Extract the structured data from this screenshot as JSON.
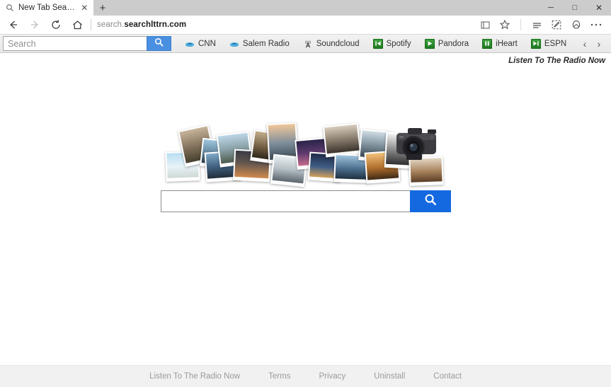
{
  "browser": {
    "tab": {
      "title": "New Tab Search",
      "favicon": "search-icon",
      "close_label": "✕"
    },
    "new_tab_label": "+",
    "window_controls": {
      "minimize": "─",
      "maximize": "□",
      "close": "✕"
    },
    "nav": {
      "back": "←",
      "forward": "→",
      "refresh": "⟳",
      "home": "⌂"
    },
    "url": {
      "prefix": "search.",
      "domain": "searchlttrn.com",
      "full": "search.searchlttrn.com"
    },
    "tools": [
      {
        "name": "reading-view-icon",
        "label": "Reading view"
      },
      {
        "name": "favorites-star-icon",
        "label": "Add to favorites"
      },
      {
        "name": "hub-icon",
        "label": "Hub"
      },
      {
        "name": "web-note-icon",
        "label": "Make a Web Note"
      },
      {
        "name": "share-icon",
        "label": "Share"
      },
      {
        "name": "more-icon",
        "label": "More"
      }
    ]
  },
  "extension_bar": {
    "search": {
      "placeholder": "Search",
      "value": "",
      "button_icon": "search-icon"
    },
    "links": [
      {
        "label": "CNN",
        "icon": "radio-blue-icon",
        "icon_style": "blue"
      },
      {
        "label": "Salem Radio",
        "icon": "radio-blue-icon",
        "icon_style": "blue"
      },
      {
        "label": "Soundcloud",
        "icon": "broadcast-tower-icon",
        "icon_style": "tower"
      },
      {
        "label": "Spotify",
        "icon": "previous-track-icon",
        "icon_style": "green"
      },
      {
        "label": "Pandora",
        "icon": "play-icon",
        "icon_style": "green"
      },
      {
        "label": "iHeart",
        "icon": "pause-icon",
        "icon_style": "green"
      },
      {
        "label": "ESPN",
        "icon": "next-track-icon",
        "icon_style": "green"
      }
    ],
    "scroll_prev": "‹",
    "scroll_next": "›"
  },
  "page": {
    "corner_tagline": "Listen To The Radio Now",
    "search": {
      "placeholder": "",
      "value": "",
      "button_icon": "search-icon"
    },
    "hero_image": "photo-collage-with-camera",
    "footer_links": [
      "Listen To The Radio Now",
      "Terms",
      "Privacy",
      "Uninstall",
      "Contact"
    ]
  },
  "colors": {
    "accent_blue": "#1569e0",
    "ext_search_blue": "#4a90e2",
    "green_icon": "#2c8c2c",
    "tabstrip_gray": "#cccccc",
    "footer_gray": "#f1f1f1",
    "footer_link_gray": "#9b9b9b"
  }
}
